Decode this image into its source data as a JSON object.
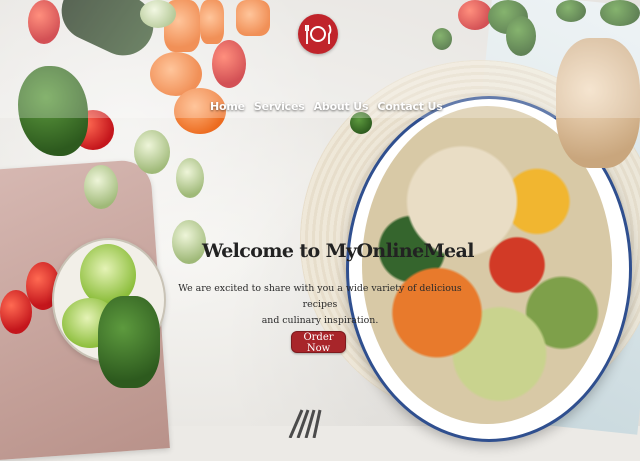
{
  "brand": {
    "logo_icon": "plate-fork-knife-icon",
    "accent": "#c0242b"
  },
  "nav": {
    "items": [
      {
        "label": "Home"
      },
      {
        "label": "Services"
      },
      {
        "label": "About Us"
      },
      {
        "label": "Contact Us"
      }
    ]
  },
  "hero": {
    "title": "Welcome to MyOnlineMeal",
    "subtitle_line1": "We are excited to share with you a wide variety of delicious recipes",
    "subtitle_line2": "and culinary inspiration.",
    "cta_label": "Order Now",
    "cta_color": "#a8252a"
  }
}
